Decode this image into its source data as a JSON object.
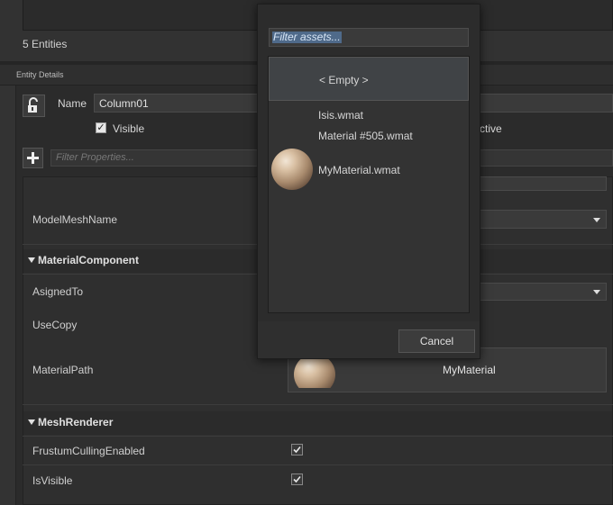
{
  "outliner": {
    "entity_count": "5 Entities"
  },
  "entity_details": {
    "title": "Entity Details",
    "name_label": "Name",
    "name_value": "Column01",
    "visible_label": "Visible",
    "visible_checked": true,
    "active_label_partial": "ctive",
    "filter_placeholder": "Filter Properties..."
  },
  "properties": {
    "model_mesh_name_label": "ModelMeshName",
    "material_component": {
      "title": "MaterialComponent",
      "asigned_to_label": "AsignedTo",
      "use_copy_label": "UseCopy",
      "material_path_label": "MaterialPath",
      "material_path_value": "MyMaterial"
    },
    "mesh_renderer": {
      "title": "MeshRenderer",
      "frustum_culling_label": "FrustumCullingEnabled",
      "frustum_culling_checked": true,
      "is_visible_label": "IsVisible",
      "is_visible_checked": true
    }
  },
  "asset_picker": {
    "filter_placeholder": "Filter assets...",
    "items": [
      {
        "label": "< Empty >",
        "selected": true,
        "has_thumbnail": false
      },
      {
        "label": "Isis.wmat",
        "selected": false,
        "has_thumbnail": false
      },
      {
        "label": "Material #505.wmat",
        "selected": false,
        "has_thumbnail": false
      },
      {
        "label": "MyMaterial.wmat",
        "selected": false,
        "has_thumbnail": true
      }
    ],
    "cancel_label": "Cancel"
  },
  "icons": {
    "lock": "lock-icon",
    "add": "plus-icon",
    "collapse": "triangle-down-icon",
    "dropdown": "chevron-down-icon",
    "check": "checkmark-icon"
  }
}
